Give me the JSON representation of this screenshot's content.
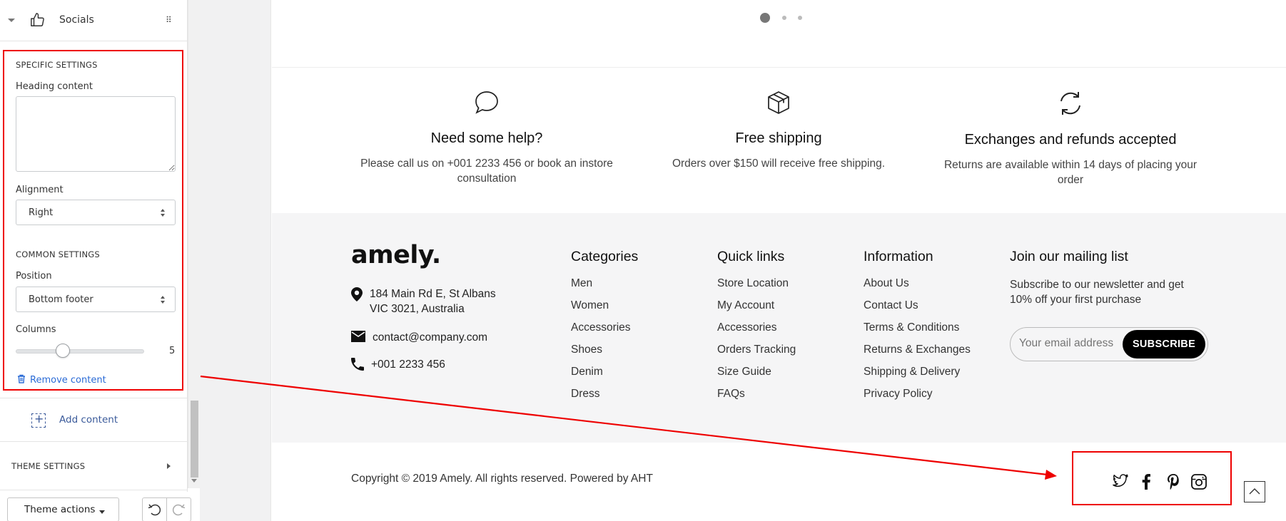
{
  "editor": {
    "section_title": "Socials",
    "specific_settings_label": "SPECIFIC SETTINGS",
    "heading_content_label": "Heading content",
    "heading_content_value": "",
    "alignment_label": "Alignment",
    "alignment_value": "Right",
    "common_settings_label": "COMMON SETTINGS",
    "position_label": "Position",
    "position_value": "Bottom footer",
    "columns_label": "Columns",
    "columns_value": "5",
    "remove_content_label": "Remove content",
    "add_content_label": "Add content",
    "theme_settings_label": "THEME SETTINGS",
    "theme_actions_label": "Theme actions"
  },
  "carousel": {
    "dots": 3,
    "active_index": 0
  },
  "features": [
    {
      "icon": "speech-bubble-icon",
      "title": "Need some help?",
      "desc_line1": "Please call us on +001 2233 456 or book an instore",
      "desc_line2": "consultation"
    },
    {
      "icon": "box-icon",
      "title": "Free shipping",
      "desc_line1": "Orders over $150 will receive free shipping.",
      "desc_line2": ""
    },
    {
      "icon": "refresh-icon",
      "title": "Exchanges and refunds accepted",
      "desc_line1": "Returns are available within 14 days of placing your",
      "desc_line2": "order"
    }
  ],
  "footer": {
    "logo": "amely.",
    "address_line1": "184 Main Rd E, St Albans",
    "address_line2": "VIC 3021, Australia",
    "email": "contact@company.com",
    "phone": "+001 2233 456",
    "categories": {
      "title": "Categories",
      "links": [
        "Men",
        "Women",
        "Accessories",
        "Shoes",
        "Denim",
        "Dress"
      ]
    },
    "quick_links": {
      "title": "Quick links",
      "links": [
        "Store Location",
        "My Account",
        "Accessories",
        "Orders Tracking",
        "Size Guide",
        "FAQs"
      ]
    },
    "information": {
      "title": "Information",
      "links": [
        "About Us",
        "Contact Us",
        "Terms & Conditions",
        "Returns & Exchanges",
        "Shipping & Delivery",
        "Privacy Policy"
      ]
    },
    "mailing": {
      "title": "Join our mailing list",
      "desc": "Subscribe to our newsletter and get 10% off your first purchase",
      "email_placeholder": "Your email address",
      "subscribe_label": "SUBSCRIBE"
    },
    "copyright": "Copyright © 2019 Amely. All rights reserved. Powered by AHT",
    "socials": [
      "twitter-icon",
      "facebook-icon",
      "pinterest-icon",
      "instagram-icon"
    ]
  },
  "colors": {
    "highlight": "#e00000",
    "link_blue": "#2b6bd6",
    "footer_bg": "#f5f5f6"
  }
}
